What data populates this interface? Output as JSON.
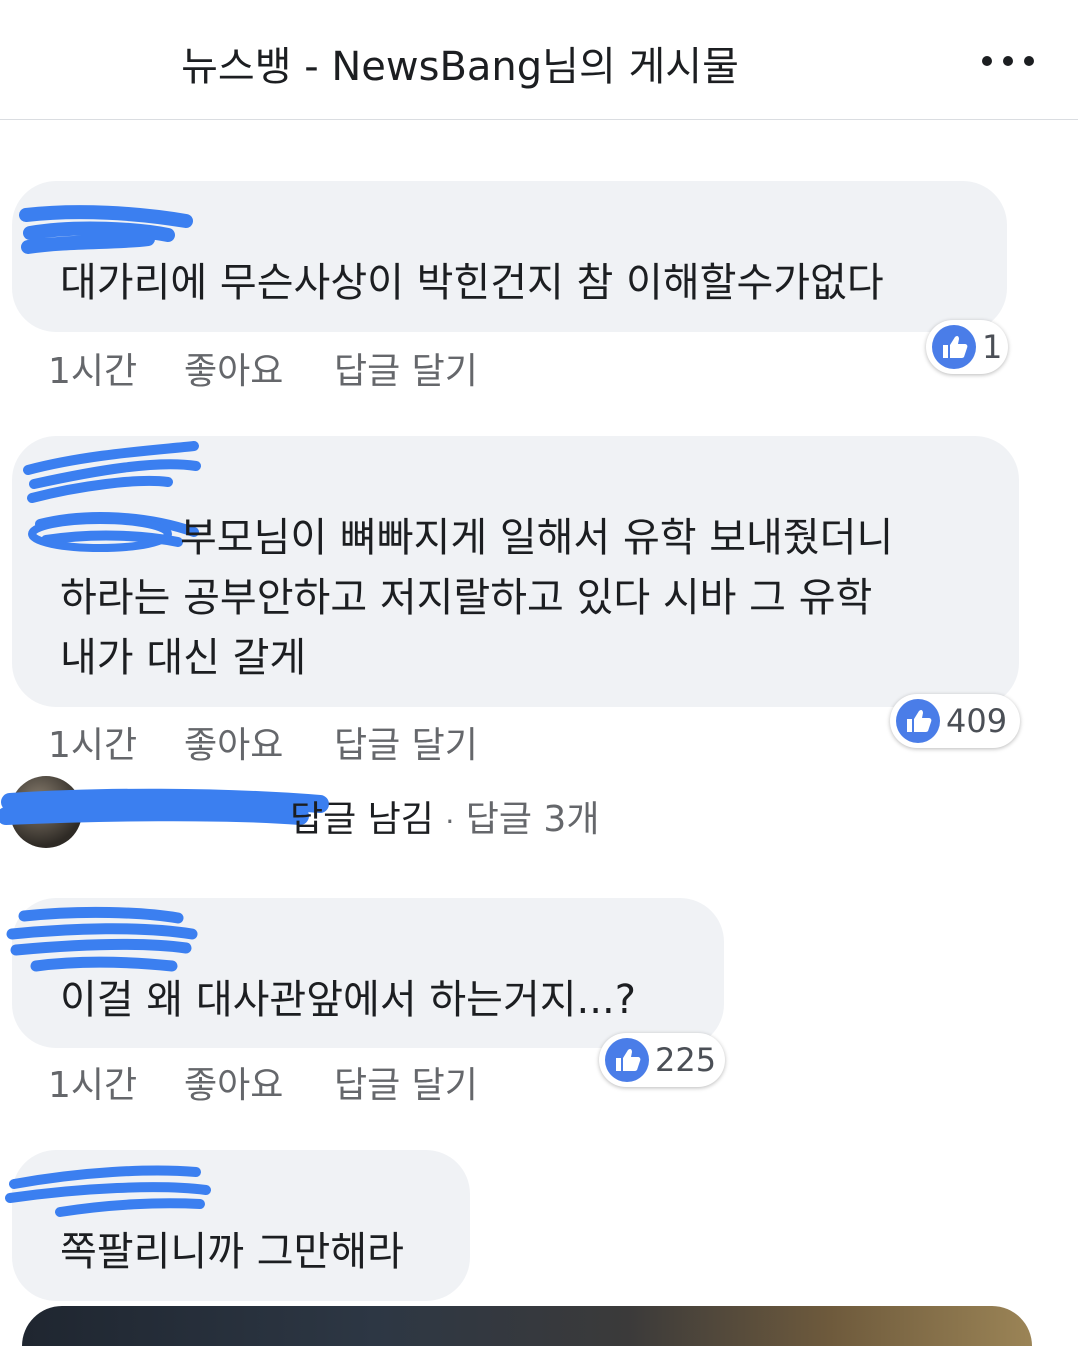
{
  "header": {
    "title": "뉴스뱅 - NewsBang님의 게시물",
    "more_icon": "more-horizontal-icon"
  },
  "comments": [
    {
      "lines": [
        "대가리에 무슨사상이 박힌건지 참 이해할수가없다"
      ],
      "time": "1시간",
      "like_label": "좋아요",
      "reply_label": "답글 달기",
      "reactions": "1"
    },
    {
      "lines": [
        "부모님이 뼈빠지게 일해서 유학 보내줬더니",
        "하라는 공부안하고 저지랄하고 있다 시바 그 유학",
        "내가 대신 갈게"
      ],
      "time": "1시간",
      "like_label": "좋아요",
      "reply_label": "답글 달기",
      "reactions": "409",
      "replies": {
        "left_text": "답글 남김",
        "separator": "·",
        "count_text": "답글 3개"
      }
    },
    {
      "lines": [
        "이걸 왜 대사관앞에서 하는거지...?"
      ],
      "time": "1시간",
      "like_label": "좋아요",
      "reply_label": "답글 달기",
      "reactions": "225"
    },
    {
      "lines": [
        "쪽팔리니까 그만해라"
      ]
    }
  ],
  "colors": {
    "bubble": "#f0f2f5",
    "like_blue": "#4a7de8",
    "redaction": "#3b7ff0",
    "meta": "#65676b"
  }
}
